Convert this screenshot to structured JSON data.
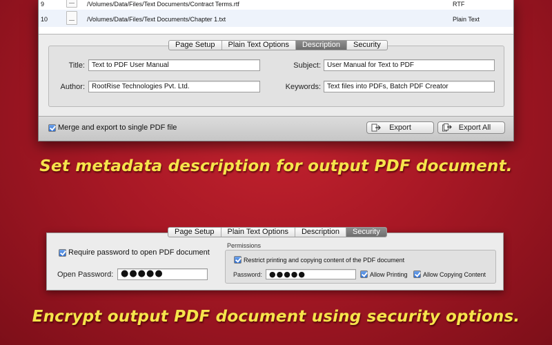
{
  "file_table": {
    "rows": [
      {
        "num": "9",
        "path": "/Volumes/Data/Files/Text Documents/Contract Terms.rtf",
        "kind": "RTF"
      },
      {
        "num": "10",
        "path": "/Volumes/Data/Files/Text Documents/Chapter 1.txt",
        "kind": "Plain Text"
      }
    ]
  },
  "tabs": [
    "Page Setup",
    "Plain Text Options",
    "Description",
    "Security"
  ],
  "description_panel": {
    "active_tab": "Description",
    "title_label": "Title:",
    "title_value": "Text to PDF User Manual",
    "subject_label": "Subject:",
    "subject_value": "User Manual for Text to PDF",
    "author_label": "Author:",
    "author_value": "RootRise Technologies Pvt. Ltd.",
    "keywords_label": "Keywords:",
    "keywords_value": "Text files into PDFs, Batch PDF Creator"
  },
  "bottom_bar": {
    "merge_label": "Merge and export to single PDF file",
    "merge_checked": true,
    "export_label": "Export",
    "export_all_label": "Export All"
  },
  "captions": {
    "description": "Set metadata description for output PDF document.",
    "security": "Encrypt output PDF document using security options."
  },
  "security_panel": {
    "active_tab": "Security",
    "require_password_label": "Require password to open PDF document",
    "open_password_label": "Open Password:",
    "open_password_value": "●●●●●",
    "permissions_title": "Permissions",
    "restrict_label": "Restrict printing and copying content of the PDF document",
    "password_label": "Password:",
    "password_value": "●●●●●",
    "allow_printing_label": "Allow Printing",
    "allow_copying_label": "Allow Copying Content"
  },
  "colors": {
    "background": "#a81825",
    "caption": "#f6e44b",
    "active_tab": "#7e7e7e",
    "checkbox": "#2f6fd1"
  }
}
